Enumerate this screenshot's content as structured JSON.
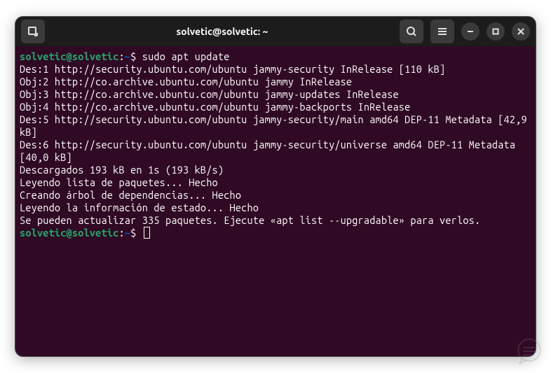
{
  "window": {
    "title": "solvetic@solvetic: ~"
  },
  "prompt": {
    "user_host": "solvetic@solvetic",
    "path": "~",
    "symbol": "$"
  },
  "command": "sudo apt update",
  "output": {
    "line1": "Des:1 http://security.ubuntu.com/ubuntu jammy-security InRelease [110 kB]",
    "line2": "Obj:2 http://co.archive.ubuntu.com/ubuntu jammy InRelease",
    "line3": "Obj:3 http://co.archive.ubuntu.com/ubuntu jammy-updates InRelease",
    "line4": "Obj:4 http://co.archive.ubuntu.com/ubuntu jammy-backports InRelease",
    "line5": "Des:5 http://security.ubuntu.com/ubuntu jammy-security/main amd64 DEP-11 Metadata [42,9 kB]",
    "line6": "Des:6 http://security.ubuntu.com/ubuntu jammy-security/universe amd64 DEP-11 Metadata [40,0 kB]",
    "line7": "Descargados 193 kB en 1s (193 kB/s)",
    "line8": "Leyendo lista de paquetes... Hecho",
    "line9": "Creando árbol de dependencias... Hecho",
    "line10": "Leyendo la información de estado... Hecho",
    "line11": "Se pueden actualizar 335 paquetes. Ejecute «apt list --upgradable» para verlos."
  }
}
